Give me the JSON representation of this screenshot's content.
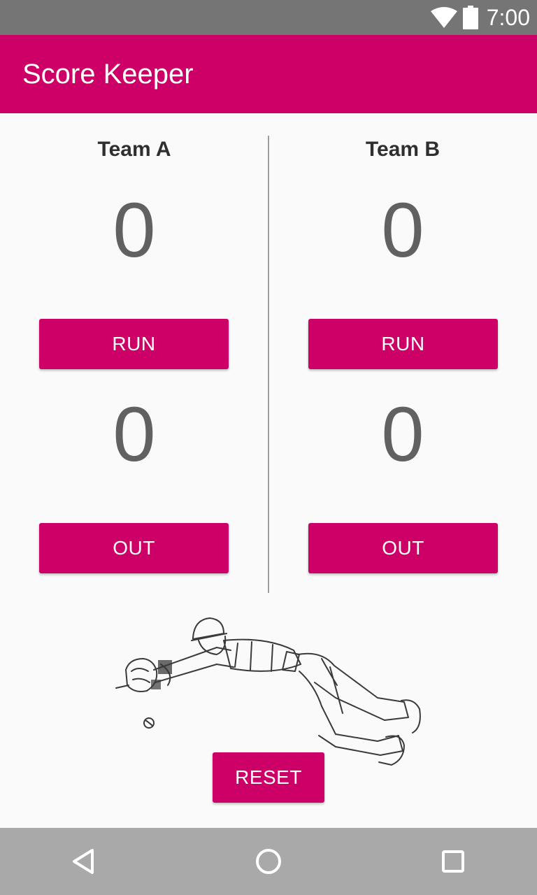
{
  "status_bar": {
    "time": "7:00",
    "icons": [
      "wifi-icon",
      "battery-icon"
    ]
  },
  "app_bar": {
    "title": "Score Keeper"
  },
  "teams": [
    {
      "name": "Team A",
      "runs": "0",
      "outs": "0",
      "run_label": "RUN",
      "out_label": "OUT"
    },
    {
      "name": "Team B",
      "runs": "0",
      "outs": "0",
      "run_label": "RUN",
      "out_label": "OUT"
    }
  ],
  "reset": {
    "label": "RESET"
  },
  "illustration": {
    "icon": "diving-baseball-player-illustration"
  },
  "nav_bar": {
    "icons": [
      "back-icon",
      "home-icon",
      "recents-icon"
    ]
  },
  "colors": {
    "accent": "#cc0066",
    "status_bar": "#757575",
    "nav_bar": "#a9a9a9",
    "score_text": "#616161"
  }
}
